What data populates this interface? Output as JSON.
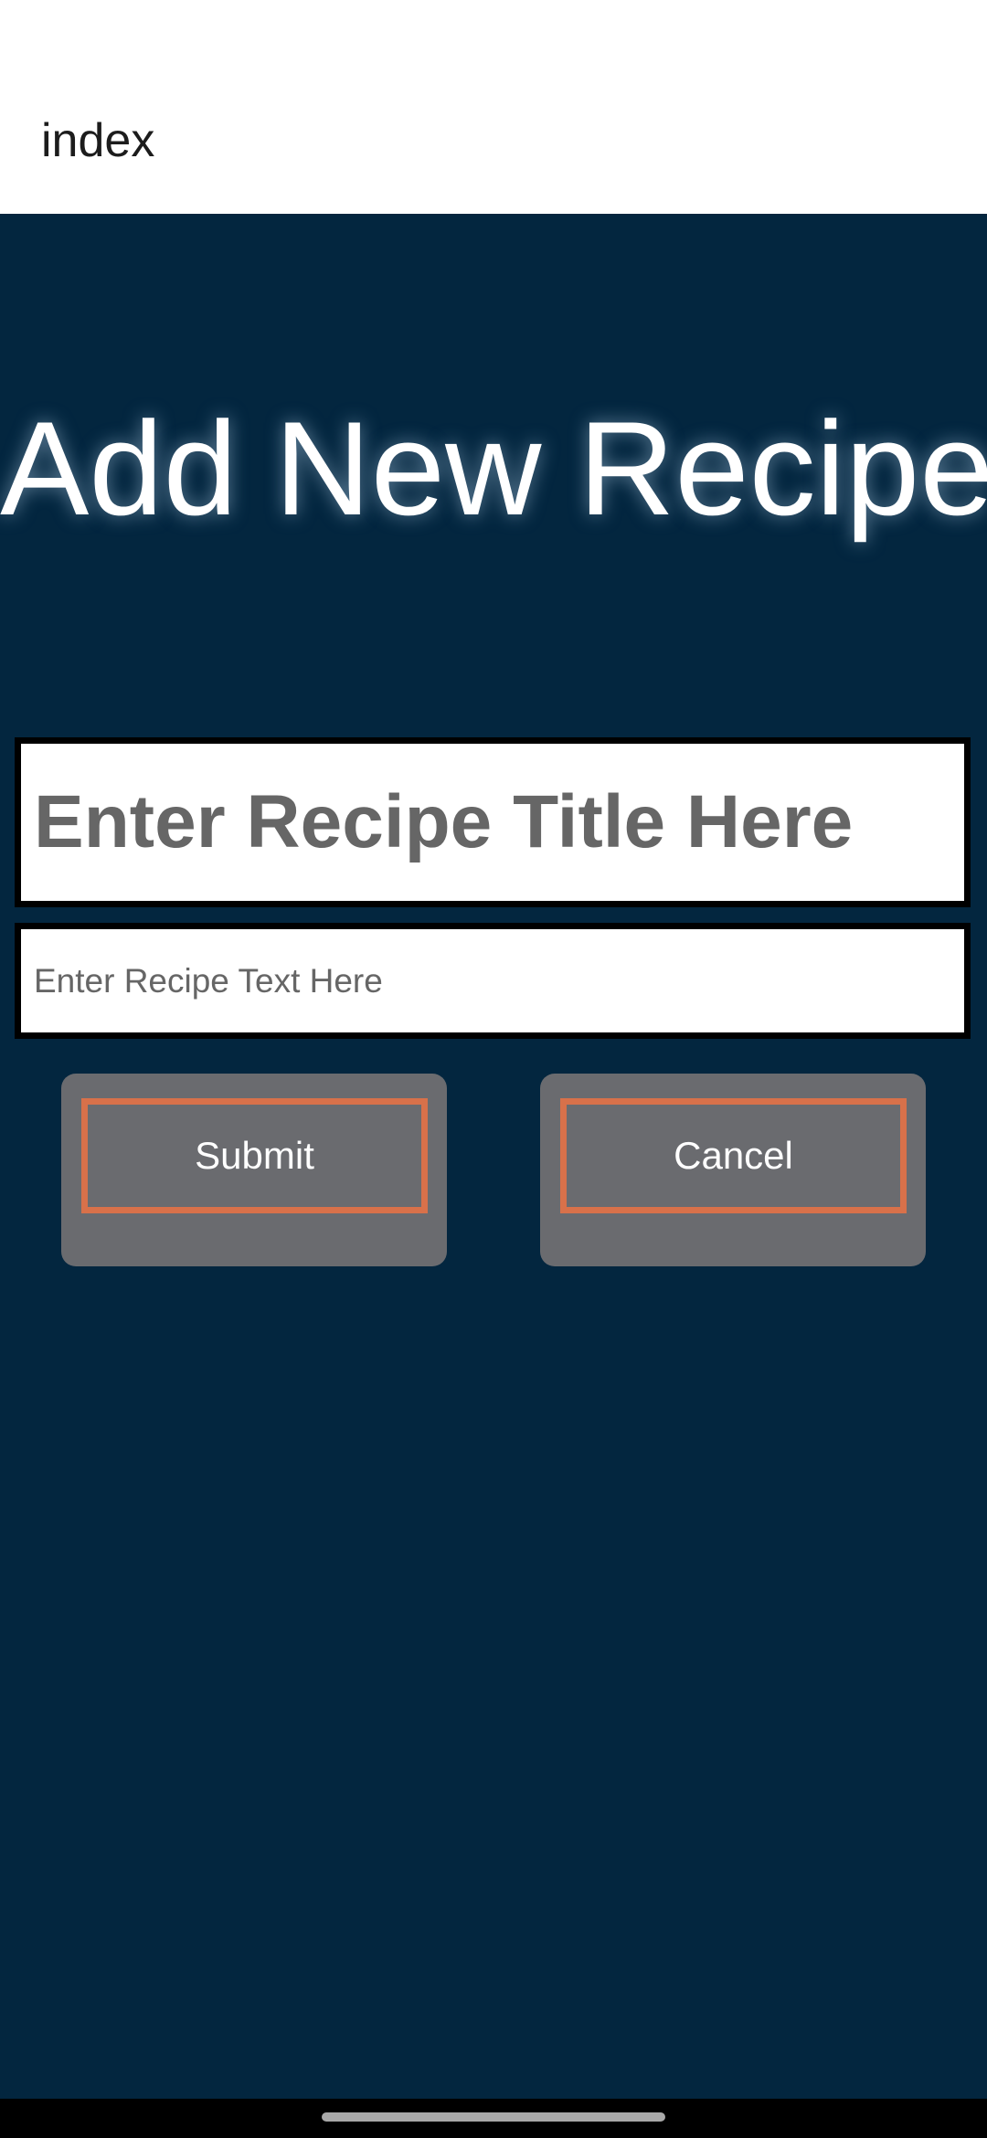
{
  "header": {
    "title": "index"
  },
  "main": {
    "title": "Add New Recipe",
    "title_input": {
      "placeholder": "Enter Recipe Title Here",
      "value": ""
    },
    "text_input": {
      "placeholder": "Enter Recipe Text Here",
      "value": ""
    },
    "submit_label": "Submit",
    "cancel_label": "Cancel"
  },
  "colors": {
    "background": "#03263f",
    "button": "#6a6b6f",
    "accent_border": "#d8714a"
  }
}
